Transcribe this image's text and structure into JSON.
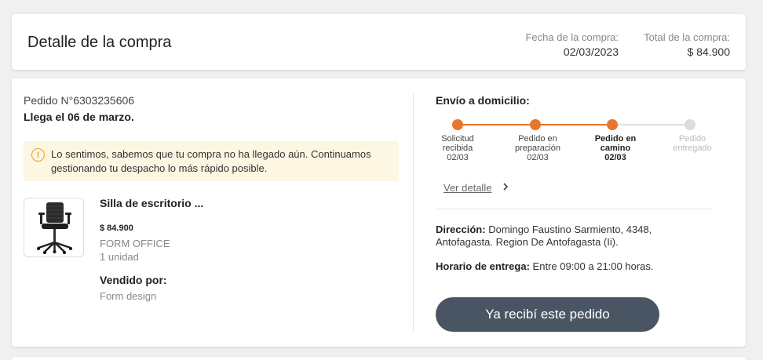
{
  "header": {
    "title": "Detalle de la compra",
    "purchase_date_label": "Fecha de la compra:",
    "purchase_date": "02/03/2023",
    "total_label": "Total de la compra:",
    "total": "$ 84.900"
  },
  "order": {
    "number": "Pedido N°6303235606",
    "arrives": "Llega el 06 de marzo."
  },
  "alert": {
    "icon": "warning-info-icon",
    "icon_glyph": "!",
    "color": "#e8a317",
    "text": "Lo sentimos, sabemos que tu compra no ha llegado aún. Continuamos gestionando tu despacho lo más rápido posible."
  },
  "product": {
    "image": "office-chair",
    "name": "Silla de escritorio ...",
    "price": "$ 84.900",
    "brand": "FORM OFFICE",
    "quantity": "1 unidad",
    "sold_by_label": "Vendido por:",
    "sold_by": "Form design"
  },
  "shipping": {
    "title": "Envío a domicilio:",
    "accent_color": "#e8762d",
    "steps": [
      {
        "line1": "Solicitud",
        "line2": "recibida",
        "date": "02/03",
        "state": "done"
      },
      {
        "line1": "Pedido en",
        "line2": "preparación",
        "date": "02/03",
        "state": "done"
      },
      {
        "line1": "Pedido en",
        "line2": "camino",
        "date": "02/03",
        "state": "current"
      },
      {
        "line1": "Pedido",
        "line2": "entregado",
        "date": "",
        "state": "pending"
      }
    ],
    "detail_link": "Ver detalle",
    "address_label": "Dirección:",
    "address": "Domingo Faustino Sarmiento, 4348, Antofagasta. Region De Antofagasta (Ii).",
    "hours_label": "Horario de entrega:",
    "hours": "Entre 09:00 a 21:00 horas.",
    "received_button": "Ya recibí este pedido"
  }
}
